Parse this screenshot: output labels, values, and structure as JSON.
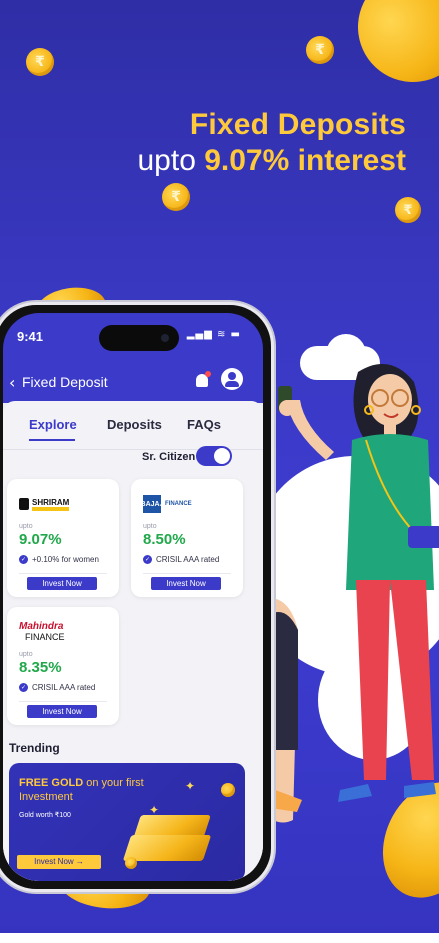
{
  "banner": {
    "headline_line1": "Fixed Deposits",
    "headline_line2_prefix": "upto ",
    "headline_line2_rate": "9.07% interest",
    "coin_symbol": "₹",
    "colors": {
      "background": "#3a39c4",
      "accent": "#ffc93c"
    }
  },
  "status_bar": {
    "time": "9:41",
    "icons": "▂▄▆ ≋ ▬"
  },
  "app_bar": {
    "back_icon": "‹",
    "title": "Fixed Deposit",
    "icons": [
      "bell-icon",
      "profile-icon"
    ]
  },
  "tabs": [
    {
      "label": "Explore",
      "active": true
    },
    {
      "label": "Deposits",
      "active": false
    },
    {
      "label": "FAQs",
      "active": false
    }
  ],
  "sr_citizen": {
    "label": "Sr. Citizen",
    "on": true
  },
  "cards": [
    {
      "issuer": "SHRIRAM",
      "issuer_sub": "Finance",
      "upto": "upto",
      "rate": "9.07%",
      "feature": "+0.10% for women",
      "button": "Invest Now"
    },
    {
      "issuer": "BAJAJ",
      "issuer_sub": "FINANCE",
      "upto": "upto",
      "rate": "8.50%",
      "feature": "CRISIL AAA rated",
      "button": "Invest Now"
    },
    {
      "issuer": "Mahindra",
      "issuer_sub": "FINANCE",
      "upto": "upto",
      "rate": "8.35%",
      "feature": "CRISIL AAA rated",
      "button": "Invest Now"
    }
  ],
  "trending": {
    "title": "Trending",
    "promo": {
      "headline_bold": "FREE GOLD",
      "headline_rest": " on your first",
      "headline_line2": "Investment",
      "note": "Gold worth ₹100",
      "button": "Invest Now →"
    }
  }
}
